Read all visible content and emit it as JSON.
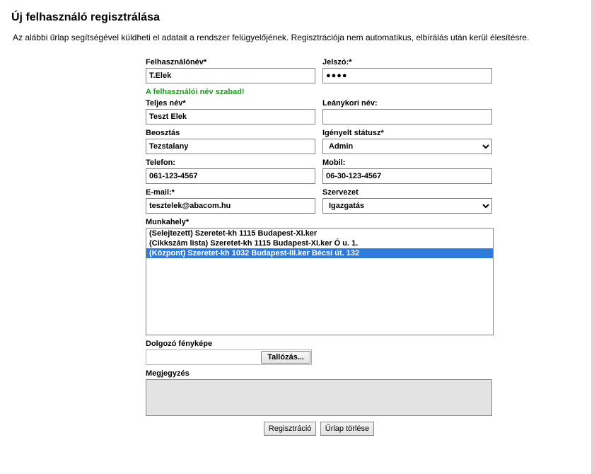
{
  "title": "Új felhasználó regisztrálása",
  "intro": "Az alábbi űrlap segítségével küldheti el adatait a rendszer felügyelőjének. Regisztrációja nem automatikus, elbírálás után kerül élesítésre.",
  "labels": {
    "username": "Felhasználónév*",
    "password": "Jelszó:*",
    "username_hint": "A felhasználói név szabad!",
    "fullname": "Teljes név*",
    "maidenname": "Leánykori név:",
    "position": "Beosztás",
    "status": "Igényelt státusz*",
    "phone": "Telefon:",
    "mobile": "Mobil:",
    "email": "E-mail:*",
    "org": "Szervezet",
    "workplace": "Munkahely*",
    "photo": "Dolgozó fényképe",
    "browse": "Tallózás...",
    "note": "Megjegyzés",
    "register": "Regisztráció",
    "clear": "Űrlap törlése"
  },
  "values": {
    "username": "T.Elek",
    "password": "●●●●",
    "fullname": "Teszt Elek",
    "maidenname": "",
    "position": "Tezstalany",
    "status": "Admin",
    "phone": "061-123-4567",
    "mobile": "06-30-123-4567",
    "email": "tesztelek@abacom.hu",
    "org": "Igazgatás",
    "note": ""
  },
  "workplace_options": [
    {
      "label": "(Selejtezett) Szeretet-kh 1115 Budapest-XI.ker",
      "selected": false
    },
    {
      "label": "(Cikkszám lista) Szeretet-kh 1115 Budapest-XI.ker Ó u. 1.",
      "selected": false
    },
    {
      "label": "(Központ) Szeretet-kh 1032 Budapest-III.ker Bécsi út. 132",
      "selected": true
    }
  ]
}
